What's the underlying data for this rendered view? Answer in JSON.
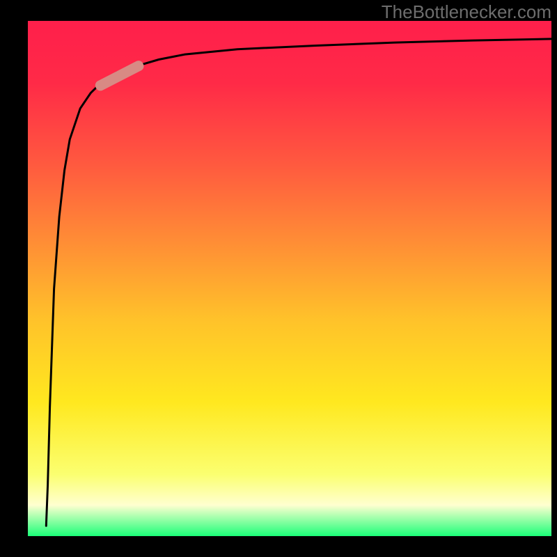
{
  "chart_data": {
    "type": "line",
    "title": "",
    "xlabel": "",
    "ylabel": "",
    "xlim": [
      0,
      100
    ],
    "ylim": [
      0,
      100
    ],
    "series": [
      {
        "name": "curve",
        "x": [
          3.5,
          3.8,
          4.2,
          5.0,
          6.0,
          7.0,
          8.0,
          10,
          12,
          14,
          17,
          20,
          25,
          30,
          40,
          55,
          70,
          85,
          100
        ],
        "values": [
          2,
          10,
          25,
          48,
          62,
          71,
          77,
          83,
          86,
          88,
          90,
          91,
          92.5,
          93.5,
          94.5,
          95.2,
          95.8,
          96.2,
          96.5
        ]
      }
    ],
    "highlight_segment": {
      "x_start": 13,
      "x_end": 22,
      "y_start": 87,
      "y_end": 91.7
    },
    "gradient_stops": [
      {
        "offset": 0.0,
        "color": "#ff1f4b"
      },
      {
        "offset": 0.12,
        "color": "#ff2a47"
      },
      {
        "offset": 0.28,
        "color": "#ff5a3f"
      },
      {
        "offset": 0.42,
        "color": "#ff8a36"
      },
      {
        "offset": 0.58,
        "color": "#ffc22a"
      },
      {
        "offset": 0.74,
        "color": "#ffe81f"
      },
      {
        "offset": 0.88,
        "color": "#fbff70"
      },
      {
        "offset": 0.94,
        "color": "#ffffd0"
      },
      {
        "offset": 1.0,
        "color": "#1bff78"
      }
    ],
    "frame_color": "#000000",
    "curve_color": "#000000",
    "highlight_color": "#d88a84"
  },
  "watermark": "TheBottlenecker.com"
}
